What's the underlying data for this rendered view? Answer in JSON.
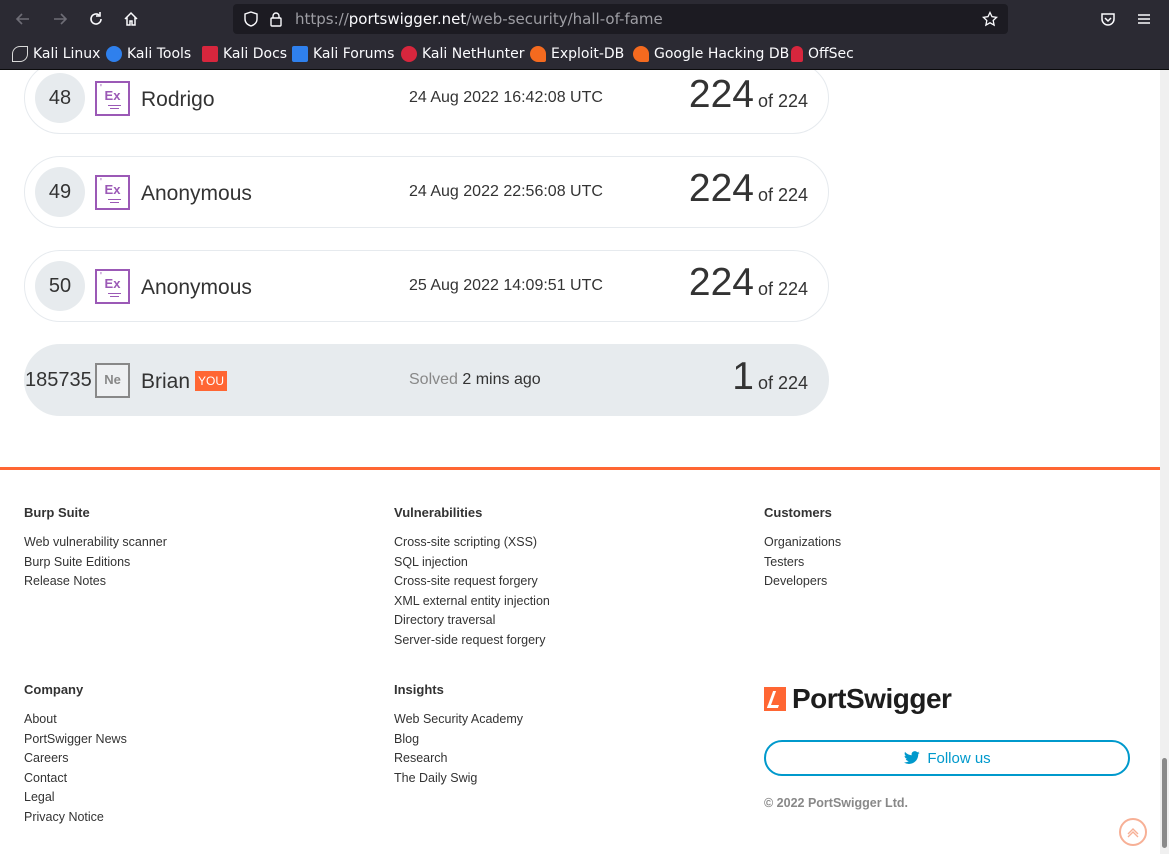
{
  "browser": {
    "url_scheme": "https://",
    "url_host": "portswigger.net",
    "url_path": "/web-security/hall-of-fame",
    "bookmarks": [
      {
        "label": "Kali Linux",
        "color": "#d9d9d9"
      },
      {
        "label": "Kali Tools",
        "color": "#e25a5a"
      },
      {
        "label": "Kali Docs",
        "color": "#d7263d"
      },
      {
        "label": "Kali Forums",
        "color": "#2f80ed"
      },
      {
        "label": "Kali NetHunter",
        "color": "#d7263d"
      },
      {
        "label": "Exploit-DB",
        "color": "#f46a1f"
      },
      {
        "label": "Google Hacking DB",
        "color": "#f46a1f"
      },
      {
        "label": "OffSec",
        "color": "#d7263d"
      }
    ]
  },
  "leaderboard": {
    "rows": [
      {
        "rank": "48",
        "badge": "Ex",
        "name": "Rodrigo",
        "time": "24 Aug 2022 16:42:08 UTC",
        "score": "224",
        "of": "of 224"
      },
      {
        "rank": "49",
        "badge": "Ex",
        "name": "Anonymous",
        "time": "24 Aug 2022 22:56:08 UTC",
        "score": "224",
        "of": "of 224"
      },
      {
        "rank": "50",
        "badge": "Ex",
        "name": "Anonymous",
        "time": "25 Aug 2022 14:09:51 UTC",
        "score": "224",
        "of": "of 224"
      }
    ],
    "you": {
      "rank": "185735",
      "badge": "Ne",
      "name": "Brian",
      "tag": "YOU",
      "solved_label": "Solved",
      "solved_time": "2 mins ago",
      "score": "1",
      "of": "of 224"
    }
  },
  "footer": {
    "columns": [
      {
        "title": "Burp Suite",
        "links": [
          "Web vulnerability scanner",
          "Burp Suite Editions",
          "Release Notes"
        ]
      },
      {
        "title": "Vulnerabilities",
        "links": [
          "Cross-site scripting (XSS)",
          "SQL injection",
          "Cross-site request forgery",
          "XML external entity injection",
          "Directory traversal",
          "Server-side request forgery"
        ]
      },
      {
        "title": "Customers",
        "links": [
          "Organizations",
          "Testers",
          "Developers"
        ]
      },
      {
        "title": "Company",
        "links": [
          "About",
          "PortSwigger News",
          "Careers",
          "Contact",
          "Legal",
          "Privacy Notice"
        ]
      },
      {
        "title": "Insights",
        "links": [
          "Web Security Academy",
          "Blog",
          "Research",
          "The Daily Swig"
        ]
      }
    ],
    "logo_text": "PortSwigger",
    "follow_label": "Follow us",
    "copyright": "© 2022 PortSwigger Ltd.",
    "accent_color": "#ff6633",
    "twitter_color": "#0099cc"
  }
}
